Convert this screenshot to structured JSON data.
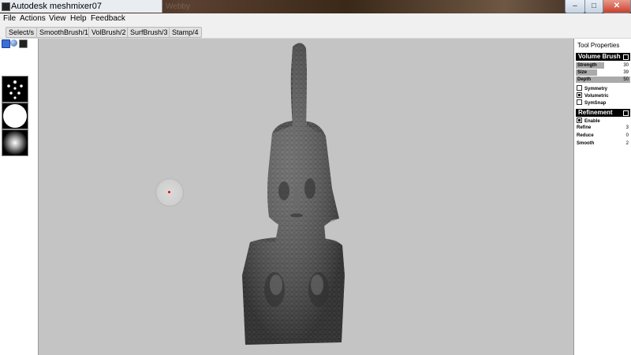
{
  "window": {
    "title": "Autodesk meshmixer07",
    "background_ghost_text": "Webby"
  },
  "menu": {
    "items": [
      "File",
      "Actions",
      "View",
      "Help",
      "Feedback"
    ]
  },
  "toolbar": {
    "buttons": [
      "Select/s",
      "SmoothBrush/1",
      "VolBrush/2",
      "SurfBrush/3",
      "Stamp/4"
    ]
  },
  "tool_properties": {
    "title": "Tool Properties",
    "volume_brush": {
      "header": "Volume Brush",
      "sliders": [
        {
          "label": "Strength",
          "value": "30",
          "fraction": 0.52
        },
        {
          "label": "Size",
          "value": "39",
          "fraction": 0.39
        },
        {
          "label": "Depth",
          "value": "50",
          "fraction": 1.0
        }
      ],
      "checkboxes": [
        {
          "label": "Symmetry",
          "checked": false
        },
        {
          "label": "Volumetric",
          "checked": true
        },
        {
          "label": "SymSnap",
          "checked": false
        }
      ]
    },
    "refinement": {
      "header": "Refinement",
      "enable": {
        "label": "Enable",
        "checked": true
      },
      "rows": [
        {
          "label": "Refine",
          "value": "3"
        },
        {
          "label": "Reduce",
          "value": "0"
        },
        {
          "label": "Smooth",
          "value": "2"
        }
      ]
    }
  },
  "colors": {
    "viewport": "#c4c4c4",
    "mesh": "#555555",
    "cursor_dot": "#e00000"
  }
}
